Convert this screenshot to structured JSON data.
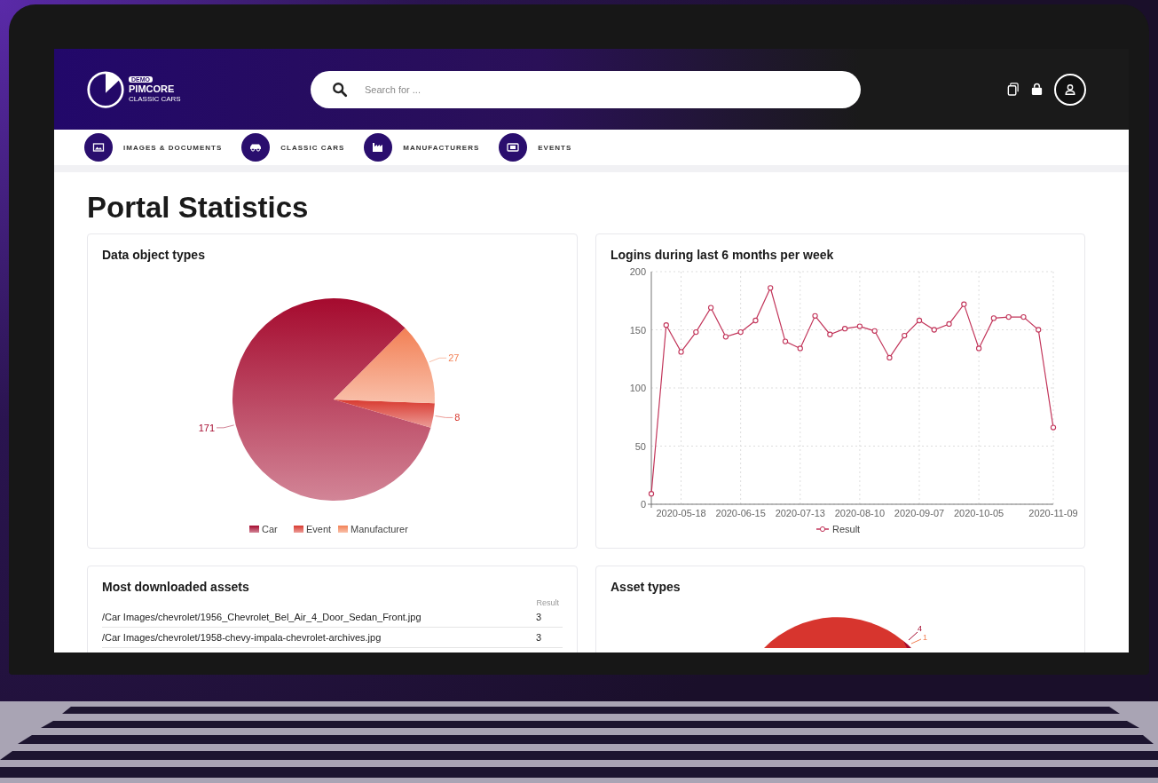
{
  "header": {
    "logo": {
      "badge": "DEMO",
      "name": "PIMCORE",
      "tagline": "CLASSIC CARS"
    },
    "search": {
      "placeholder": "Search for ..."
    }
  },
  "nav": [
    {
      "label": "IMAGES & DOCUMENTS",
      "kind": "images"
    },
    {
      "label": "CLASSIC CARS",
      "kind": "car"
    },
    {
      "label": "MANUFACTURERS",
      "kind": "factory"
    },
    {
      "label": "EVENTS",
      "kind": "events"
    }
  ],
  "page_title": "Portal Statistics",
  "data_object_types": {
    "chart_data": {
      "type": "pie",
      "title": "Data object types",
      "data_labels": true,
      "legend": "bottom",
      "categories": [
        "Car",
        "Event",
        "Manufacturer"
      ],
      "values": [
        171,
        8,
        27
      ],
      "colors": [
        "#a50a2e",
        "#d8392f",
        "#f28055"
      ]
    }
  },
  "logins": {
    "chart_data": {
      "type": "line",
      "title": "Logins during last 6 months per week",
      "grid": true,
      "ylim": [
        0,
        200
      ],
      "yticks": [
        0,
        50,
        100,
        150,
        200
      ],
      "categories": [
        null,
        null,
        "2020-05-18",
        null,
        null,
        null,
        "2020-06-15",
        null,
        null,
        null,
        "2020-07-13",
        null,
        null,
        null,
        "2020-08-10",
        null,
        null,
        null,
        "2020-09-07",
        null,
        null,
        null,
        "2020-10-05",
        null,
        null,
        null,
        null,
        "2020-11-09"
      ],
      "series": [
        {
          "name": "Result",
          "color": "#c2355a",
          "marker": "circle",
          "values": [
            9,
            154,
            131,
            148,
            169,
            144,
            148,
            158,
            186,
            140,
            134,
            162,
            146,
            151,
            153,
            149,
            126,
            145,
            158,
            150,
            155,
            172,
            134,
            160,
            161,
            161,
            150,
            66
          ]
        }
      ]
    }
  },
  "most_downloaded": {
    "title": "Most downloaded assets",
    "columns": [
      "Result"
    ],
    "rows": [
      {
        "path": "/Car Images/chevrolet/1956_Chevrolet_Bel_Air_4_Door_Sedan_Front.jpg",
        "result": "3"
      },
      {
        "path": "/Car Images/chevrolet/1958-chevy-impala-chevrolet-archives.jpg",
        "result": "3"
      }
    ]
  },
  "asset_types": {
    "title": "Asset types",
    "slice_labels": [
      "4",
      "1"
    ]
  }
}
